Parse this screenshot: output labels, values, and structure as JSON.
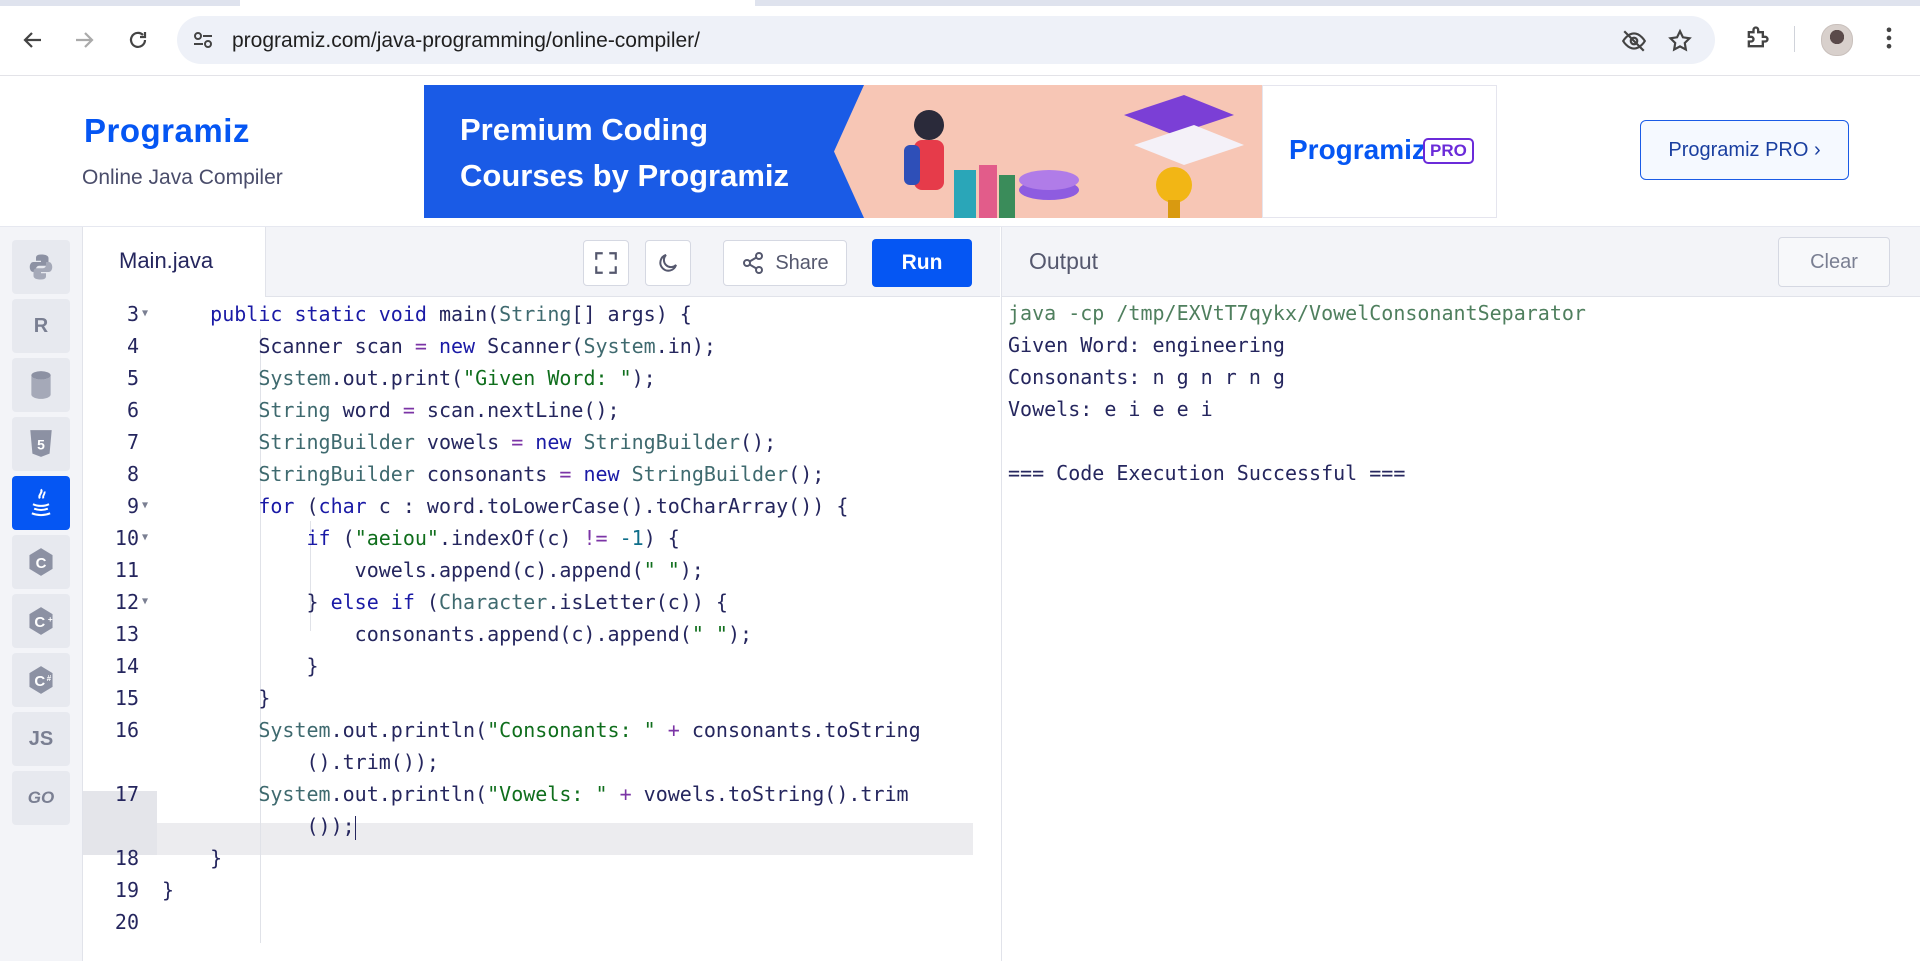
{
  "browser": {
    "url": "programiz.com/java-programming/online-compiler/"
  },
  "header": {
    "logo_text": "Programiz",
    "subtitle": "Online Java Compiler",
    "banner_line1": "Premium Coding",
    "banner_line2": "Courses by Programiz",
    "banner_logo": "Programiz",
    "banner_badge": "PRO",
    "pro_button": "Programiz PRO ›"
  },
  "sidebar": {
    "languages": [
      {
        "name": "python",
        "label": "",
        "icon": "python-icon"
      },
      {
        "name": "r",
        "label": "R",
        "icon": "r-icon"
      },
      {
        "name": "sql",
        "label": "",
        "icon": "database-icon"
      },
      {
        "name": "html",
        "label": "5",
        "icon": "html5-icon"
      },
      {
        "name": "java",
        "label": "",
        "icon": "java-icon",
        "active": true
      },
      {
        "name": "c",
        "label": "C",
        "icon": "c-icon"
      },
      {
        "name": "cpp",
        "label": "C",
        "icon": "cpp-icon"
      },
      {
        "name": "csharp",
        "label": "C",
        "icon": "csharp-icon"
      },
      {
        "name": "js",
        "label": "JS",
        "icon": "js-icon"
      },
      {
        "name": "go",
        "label": "GO",
        "icon": "go-icon"
      }
    ]
  },
  "editor": {
    "filename": "Main.java",
    "share_label": "Share",
    "run_label": "Run",
    "line_numbers": [
      "3",
      "4",
      "5",
      "6",
      "7",
      "8",
      "9",
      "10",
      "11",
      "12",
      "13",
      "14",
      "15",
      "16",
      "17",
      "18",
      "19",
      "20"
    ]
  },
  "output": {
    "title": "Output",
    "clear_label": "Clear",
    "command": "java -cp /tmp/EXVtT7qykx/VowelConsonantSeparator",
    "lines": [
      "Given Word: engineering",
      "Consonants: n g n r n g",
      "Vowels: e i e e i",
      "",
      "=== Code Execution Successful ==="
    ]
  }
}
